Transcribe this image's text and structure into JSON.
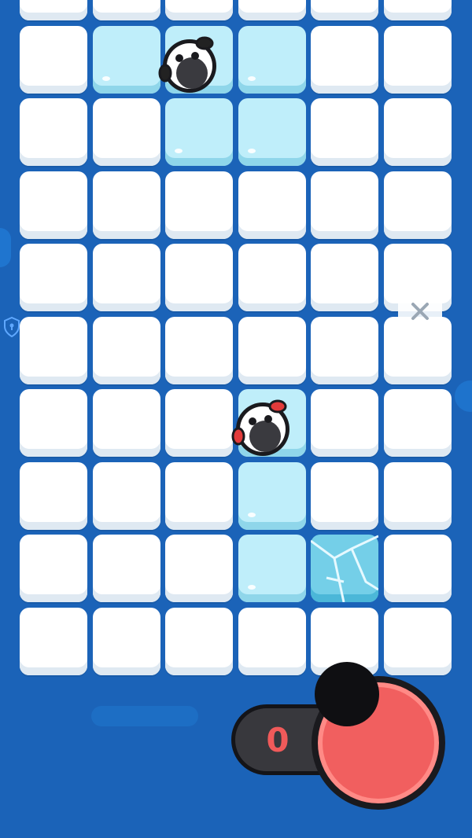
{
  "game": {
    "score_counter": "0"
  },
  "grid": {
    "rows": 10,
    "cols": 6,
    "tiles": [
      [
        "snow",
        "snow",
        "snow",
        "snow",
        "snow",
        "snow"
      ],
      [
        "snow",
        "ice",
        "ice",
        "ice",
        "snow",
        "snow"
      ],
      [
        "snow",
        "snow",
        "ice",
        "ice",
        "snow",
        "snow"
      ],
      [
        "snow",
        "snow",
        "snow",
        "snow",
        "snow",
        "snow"
      ],
      [
        "snow",
        "snow",
        "snow",
        "snow",
        "snow",
        "snow"
      ],
      [
        "snow",
        "snow",
        "snow",
        "snow",
        "snow",
        "snow"
      ],
      [
        "snow",
        "snow",
        "snow",
        "ice",
        "snow",
        "snow"
      ],
      [
        "snow",
        "snow",
        "snow",
        "ice",
        "snow",
        "snow"
      ],
      [
        "snow",
        "snow",
        "snow",
        "ice",
        "cracked",
        "snow"
      ],
      [
        "snow",
        "snow",
        "snow",
        "snow",
        "snow",
        "snow"
      ]
    ]
  },
  "players": [
    {
      "name": "penguin-player-1",
      "row": 1,
      "col": 2,
      "accent": "#222222"
    },
    {
      "name": "penguin-player-2",
      "row": 6,
      "col": 3,
      "accent": "#e23b3b"
    }
  ],
  "colors": {
    "background": "#1b63b8",
    "snow": "#ffffff",
    "ice": "#bfeefa",
    "cracked_ice": "#74cfe8",
    "action_button": "#f15f5f",
    "counter_text": "#f05a5a"
  },
  "icons": {
    "close": "close-icon",
    "shield": "shield-lock-icon",
    "action": "action-button"
  }
}
